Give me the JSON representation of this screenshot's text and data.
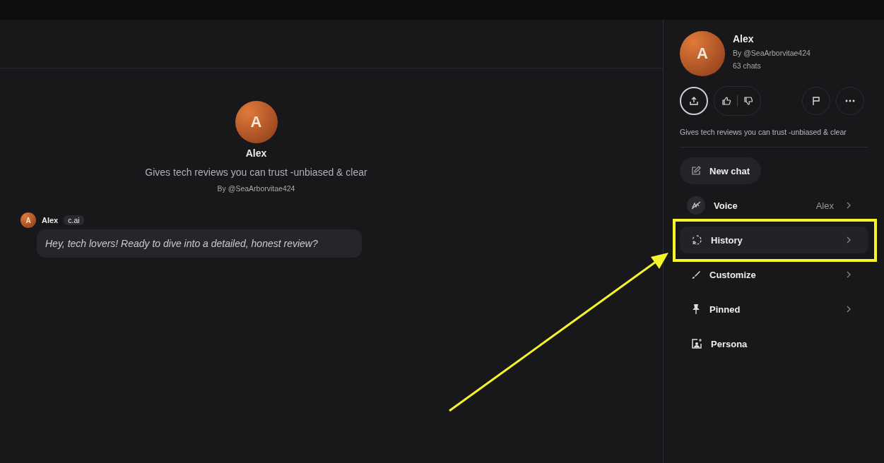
{
  "intro": {
    "avatar_letter": "A",
    "name": "Alex",
    "tagline": "Gives tech reviews you can trust -unbiased & clear",
    "creator": "By @SeaArborvitae424"
  },
  "messages": [
    {
      "avatar_letter": "A",
      "author": "Alex",
      "badge": "c.ai",
      "text": "Hey, tech lovers! Ready to dive into a detailed, honest review?"
    }
  ],
  "panel": {
    "avatar_letter": "A",
    "name": "Alex",
    "creator": "By @SeaArborvitae424",
    "chats": "63 chats",
    "description": "Gives tech reviews you can trust -unbiased & clear",
    "actions": [
      {
        "kind": "share",
        "selected": true
      },
      {
        "kind": "vote",
        "selected": false
      },
      {
        "kind": "flag",
        "selected": false
      },
      {
        "kind": "more",
        "selected": false
      }
    ],
    "items": [
      {
        "kind": "newchat",
        "label": "New chat",
        "highlighted": false
      },
      {
        "kind": "voice",
        "label": "Voice",
        "value": "Alex",
        "highlighted": false
      },
      {
        "kind": "history",
        "label": "History",
        "highlighted": true
      },
      {
        "kind": "customize",
        "label": "Customize",
        "highlighted": false
      },
      {
        "kind": "pinned",
        "label": "Pinned",
        "highlighted": false
      },
      {
        "kind": "persona",
        "label": "Persona",
        "highlighted": false
      }
    ]
  }
}
